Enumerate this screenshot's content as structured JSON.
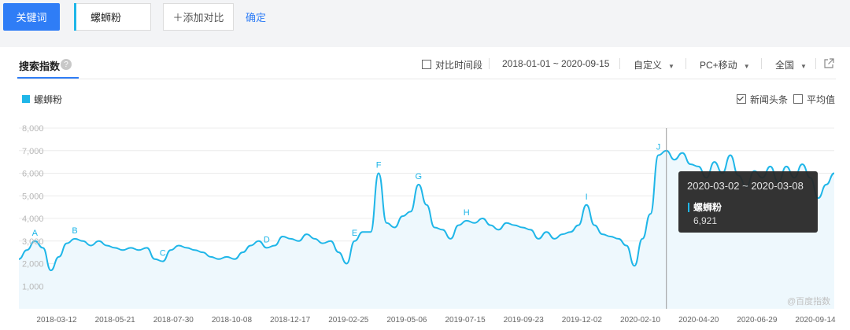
{
  "topbar": {
    "keyword_button": "关键词",
    "keyword_input_value": "螺蛳粉",
    "add_compare": "＋添加对比",
    "confirm": "确定"
  },
  "panel": {
    "tab_title": "搜索指数",
    "compare_period_label": "对比时间段",
    "date_range": "2018-01-01 ~ 2020-09-15",
    "custom_label": "自定义",
    "device_label": "PC+移动",
    "region_label": "全国",
    "news_label": "新闻头条",
    "news_checked": true,
    "avg_label": "平均值",
    "avg_checked": false
  },
  "tooltip": {
    "range": "2020-03-02 ~ 2020-03-08",
    "series": "螺蛳粉",
    "value": "6,921"
  },
  "watermark": "@百度指数",
  "colors": {
    "accent": "#2f7df6",
    "series": "#1fb6e8"
  },
  "chart_data": {
    "type": "area",
    "series": [
      {
        "name": "螺蛳粉",
        "values": [
          2200,
          2600,
          3000,
          2700,
          1700,
          2300,
          2900,
          3100,
          3000,
          2800,
          3000,
          2800,
          2700,
          2600,
          2700,
          2600,
          2700,
          2200,
          2100,
          2600,
          2800,
          2700,
          2600,
          2500,
          2300,
          2200,
          2300,
          2200,
          2500,
          2800,
          3000,
          2700,
          2800,
          3200,
          3100,
          3000,
          3300,
          3100,
          2900,
          3000,
          2500,
          2000,
          3000,
          3400,
          3400,
          6000,
          3800,
          3600,
          4100,
          4300,
          5500,
          4600,
          3600,
          3500,
          3100,
          3700,
          3900,
          3800,
          4000,
          3700,
          3500,
          3800,
          3700,
          3600,
          3500,
          3100,
          3400,
          3100,
          3300,
          3400,
          3700,
          4600,
          3700,
          3300,
          3200,
          3100,
          2800,
          1900,
          3100,
          4200,
          6800,
          7000,
          6600,
          6900,
          6400,
          6300,
          5800,
          6500,
          6000,
          6800,
          5900,
          5400,
          6100,
          5800,
          6300,
          5600,
          6300,
          5800,
          6400,
          5800,
          4900,
          5500,
          6000
        ]
      }
    ],
    "x_tick_labels": [
      "2018-03-12",
      "2018-05-21",
      "2018-07-30",
      "2018-10-08",
      "2018-12-17",
      "2019-02-25",
      "2019-05-06",
      "2019-07-15",
      "2019-09-23",
      "2019-12-02",
      "2020-02-10",
      "2020-04-20",
      "2020-06-29",
      "2020-09-14"
    ],
    "y_tick_labels": [
      "1,000",
      "2,000",
      "3,000",
      "4,000",
      "5,000",
      "6,000",
      "7,000",
      "8,000"
    ],
    "ylim": [
      0,
      8000
    ],
    "legend": "top-left",
    "grid": true,
    "annotations": [
      "A",
      "B",
      "C",
      "D",
      "E",
      "F",
      "G",
      "H",
      "I",
      "J"
    ]
  }
}
